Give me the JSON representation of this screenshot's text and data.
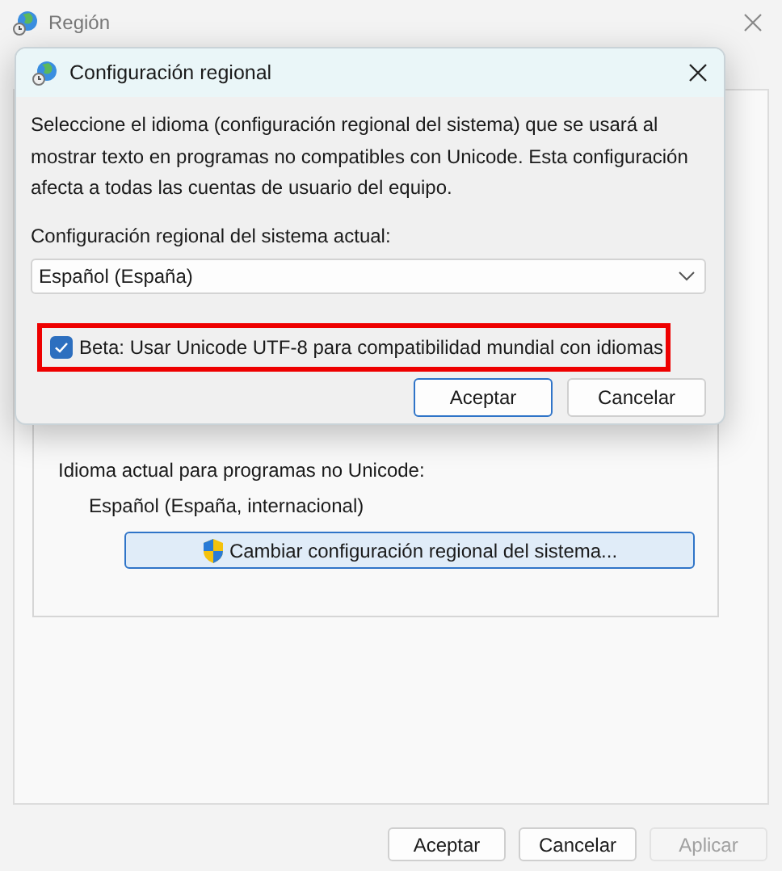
{
  "window": {
    "title": "Región"
  },
  "group": {
    "label": "Idioma actual para programas no Unicode:",
    "value": "Español (España, internacional)",
    "button": "Cambiar configuración regional del sistema..."
  },
  "buttons": [
    {
      "label": "Aceptar",
      "disabled": false
    },
    {
      "label": "Cancelar",
      "disabled": false
    },
    {
      "label": "Aplicar",
      "disabled": true
    }
  ],
  "dialog": {
    "title": "Configuración regional",
    "description": "Seleccione el idioma (configuración regional del sistema) que se usará al mostrar texto en programas no compatibles con Unicode. Esta configuración afecta a todas las cuentas de usuario del equipo.",
    "select_label": "Configuración regional del sistema actual:",
    "select_value": "Español (España)",
    "checkbox": {
      "label": "Beta: Usar Unicode UTF-8 para compatibilidad mundial con idiomas",
      "checked": true,
      "highlighted": true
    },
    "buttons": [
      {
        "label": "Aceptar",
        "default": true
      },
      {
        "label": "Cancelar",
        "default": false
      }
    ]
  }
}
